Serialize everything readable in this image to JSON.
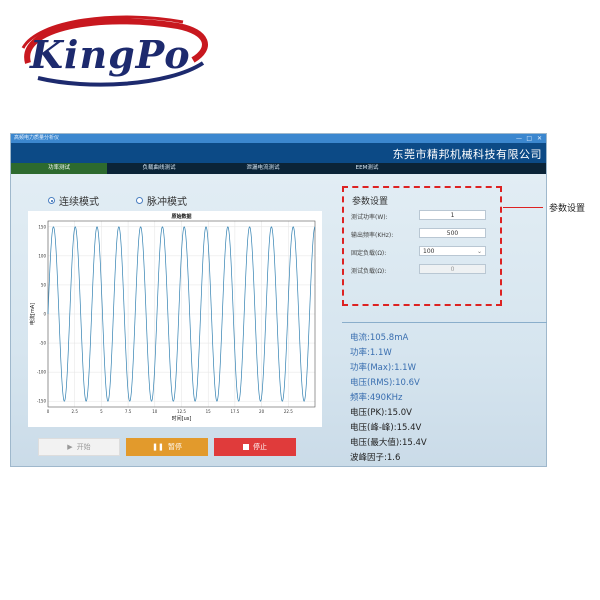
{
  "logo": {
    "text": "KingPo"
  },
  "window": {
    "title": "高频电力质量分析仪",
    "controls": [
      "—",
      "□",
      "✕"
    ],
    "company": "东莞市精邦机械科技有限公司"
  },
  "tabs": [
    {
      "label": "功率测试",
      "active": true
    },
    {
      "label": "负载曲线测试",
      "active": false
    },
    {
      "label": "泄漏电流测试",
      "active": false
    },
    {
      "label": "EEM测试",
      "active": false
    }
  ],
  "modes": {
    "continuous": {
      "label": "连续模式",
      "selected": true
    },
    "pulse": {
      "label": "脉冲模式",
      "selected": false
    }
  },
  "chart_data": {
    "type": "line",
    "title": "原始数据",
    "xlabel": "时间[us]",
    "ylabel": "电流[mA]",
    "xlim": [
      0,
      25
    ],
    "ylim": [
      -160,
      160
    ],
    "xticks": [
      "0",
      "2.5",
      "5",
      "7.5",
      "10",
      "12.5",
      "15",
      "17.5",
      "20",
      "22.5"
    ],
    "yticks": [
      "150",
      "100",
      "50",
      "0",
      "-50",
      "-100",
      "-150"
    ],
    "series": [
      {
        "frequency_mhz": 0.49,
        "amplitude": 150,
        "color": "#2f7fb0"
      }
    ],
    "grid": true
  },
  "buttons": {
    "start": "开始",
    "pause": "暂停",
    "stop": "停止"
  },
  "params": {
    "title": "参数设置",
    "rows": [
      {
        "label": "测试功率(W):",
        "value": "1"
      },
      {
        "label": "输出频率(KHz):",
        "value": "500"
      },
      {
        "label": "固定负载(Ω):",
        "value": "100"
      },
      {
        "label": "测试负载(Ω):",
        "value": "0"
      }
    ],
    "callout": "参数设置"
  },
  "results": [
    {
      "text": "电流:105.8mA",
      "color": "#3a6fb0"
    },
    {
      "text": "功率:1.1W",
      "color": "#3a6fb0"
    },
    {
      "text": "功率(Max):1.1W",
      "color": "#3a6fb0"
    },
    {
      "text": "电压(RMS):10.6V",
      "color": "#3a6fb0"
    },
    {
      "text": "频率:490KHz",
      "color": "#3a6fb0"
    },
    {
      "text": "电压(PK):15.0V",
      "color": "#222222"
    },
    {
      "text": "电压(峰-峰):15.4V",
      "color": "#222222"
    },
    {
      "text": "电压(最大值):15.4V",
      "color": "#222222"
    },
    {
      "text": "波峰因子:1.6",
      "color": "#222222"
    }
  ],
  "colors": {
    "accent_red": "#dd2222",
    "banner": "#0c4a86",
    "tab_active": "#2d6a2e"
  }
}
